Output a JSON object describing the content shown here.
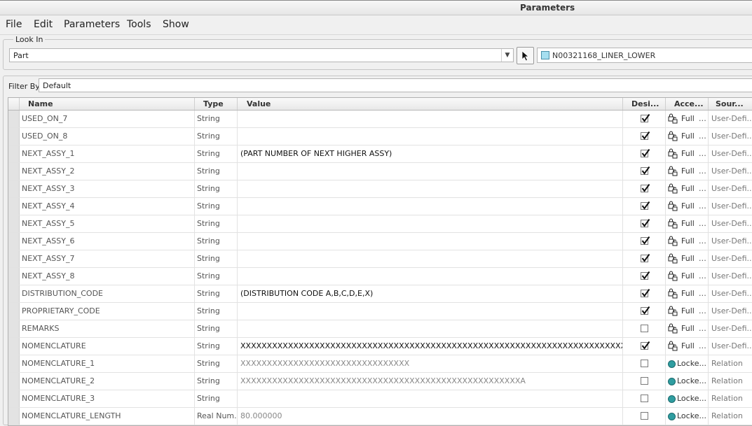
{
  "window": {
    "title": "Parameters"
  },
  "menu": [
    "File",
    "Edit",
    "Parameters",
    "Tools",
    "Show"
  ],
  "look_in": {
    "label": "Look In",
    "value": "Part",
    "model": "N00321168_LINER_LOWER"
  },
  "filter": {
    "label": "Filter By",
    "value": "Default"
  },
  "table": {
    "columns": [
      "Name",
      "Type",
      "Value",
      "Desi...",
      "Acce...",
      "Sour..."
    ],
    "rows": [
      {
        "name": "USED_ON_7",
        "type": "String",
        "value": "",
        "designated": true,
        "access": "Full",
        "source": "User-Defi..."
      },
      {
        "name": "USED_ON_8",
        "type": "String",
        "value": "",
        "designated": true,
        "access": "Full",
        "source": "User-Defi..."
      },
      {
        "name": "NEXT_ASSY_1",
        "type": "String",
        "value": "(PART NUMBER OF NEXT HIGHER ASSY)",
        "designated": true,
        "access": "Full",
        "source": "User-Defi..."
      },
      {
        "name": "NEXT_ASSY_2",
        "type": "String",
        "value": "",
        "designated": true,
        "access": "Full",
        "source": "User-Defi..."
      },
      {
        "name": "NEXT_ASSY_3",
        "type": "String",
        "value": "",
        "designated": true,
        "access": "Full",
        "source": "User-Defi..."
      },
      {
        "name": "NEXT_ASSY_4",
        "type": "String",
        "value": "",
        "designated": true,
        "access": "Full",
        "source": "User-Defi..."
      },
      {
        "name": "NEXT_ASSY_5",
        "type": "String",
        "value": "",
        "designated": true,
        "access": "Full",
        "source": "User-Defi..."
      },
      {
        "name": "NEXT_ASSY_6",
        "type": "String",
        "value": "",
        "designated": true,
        "access": "Full",
        "source": "User-Defi..."
      },
      {
        "name": "NEXT_ASSY_7",
        "type": "String",
        "value": "",
        "designated": true,
        "access": "Full",
        "source": "User-Defi..."
      },
      {
        "name": "NEXT_ASSY_8",
        "type": "String",
        "value": "",
        "designated": true,
        "access": "Full",
        "source": "User-Defi..."
      },
      {
        "name": "DISTRIBUTION_CODE",
        "type": "String",
        "value": "(DISTRIBUTION CODE A,B,C,D,E,X)",
        "designated": true,
        "access": "Full",
        "source": "User-Defi..."
      },
      {
        "name": "PROPRIETARY_CODE",
        "type": "String",
        "value": "",
        "designated": true,
        "access": "Full",
        "source": "User-Defi..."
      },
      {
        "name": "REMARKS",
        "type": "String",
        "value": "",
        "designated": false,
        "access": "Full",
        "source": "User-Defi..."
      },
      {
        "name": "NOMENCLATURE",
        "type": "String",
        "value": "XXXXXXXXXXXXXXXXXXXXXXXXXXXXXXXXXXXXXXXXXXXXXXXXXXXXXXXXXXXXXXXXXXXXXXXXXXX...",
        "designated": true,
        "access": "Full",
        "source": "User-Defi..."
      },
      {
        "name": "NOMENCLATURE_1",
        "type": "String",
        "value": "XXXXXXXXXXXXXXXXXXXXXXXXXXXXXXXX",
        "designated": false,
        "access": "Locke...",
        "source": "Relation"
      },
      {
        "name": "NOMENCLATURE_2",
        "type": "String",
        "value": "XXXXXXXXXXXXXXXXXXXXXXXXXXXXXXXXXXXXXXXXXXXXXXXXXXXXXA",
        "designated": false,
        "access": "Locke...",
        "source": "Relation"
      },
      {
        "name": "NOMENCLATURE_3",
        "type": "String",
        "value": "",
        "designated": false,
        "access": "Locke...",
        "source": "Relation"
      },
      {
        "name": "NOMENCLATURE_LENGTH",
        "type": "Real Num...",
        "value": "80.000000",
        "designated": false,
        "access": "Locke...",
        "source": "Relation"
      }
    ]
  }
}
